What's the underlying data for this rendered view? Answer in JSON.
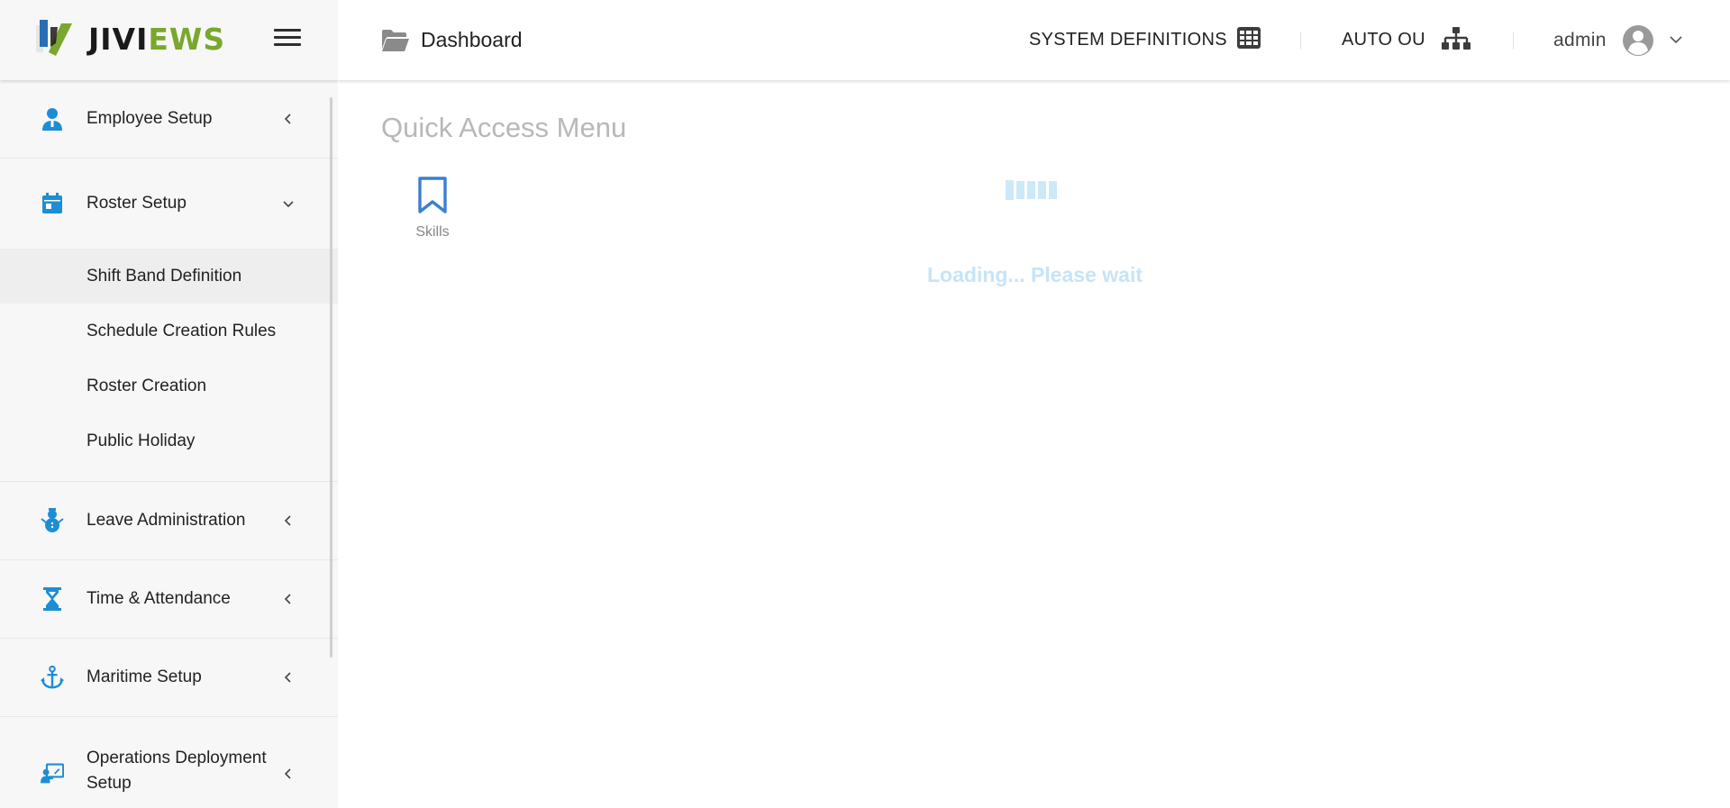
{
  "brand": {
    "part1": "JIVI",
    "part2": "EWS"
  },
  "header": {
    "breadcrumb": "Dashboard",
    "system_definitions": "SYSTEM DEFINITIONS",
    "auto_ou": "AUTO OU",
    "user": "admin"
  },
  "sidebar": {
    "items": [
      {
        "label": "Employee Setup",
        "icon": "person-icon",
        "expanded": false
      },
      {
        "label": "Roster Setup",
        "icon": "calendar-icon",
        "expanded": true
      },
      {
        "label": "Leave Administration",
        "icon": "snowman-icon",
        "expanded": false
      },
      {
        "label": "Time & Attendance",
        "icon": "hourglass-icon",
        "expanded": false
      },
      {
        "label": "Maritime Setup",
        "icon": "anchor-icon",
        "expanded": false
      },
      {
        "label": "Operations Deployment Setup",
        "icon": "presentation-icon",
        "expanded": false
      }
    ],
    "roster_subitems": [
      {
        "label": "Shift Band Definition"
      },
      {
        "label": "Schedule Creation Rules"
      },
      {
        "label": "Roster Creation"
      },
      {
        "label": "Public Holiday"
      }
    ]
  },
  "main": {
    "title": "Quick Access Menu",
    "tiles": [
      {
        "label": "Skills",
        "icon": "bookmark-icon"
      }
    ],
    "loading_text": "Loading... Please wait"
  },
  "colors": {
    "accent": "#1d8dd6",
    "brand_green": "#7aa72e",
    "loader": "#c6e4f7",
    "sidebar_bg": "#f7f7f7"
  }
}
